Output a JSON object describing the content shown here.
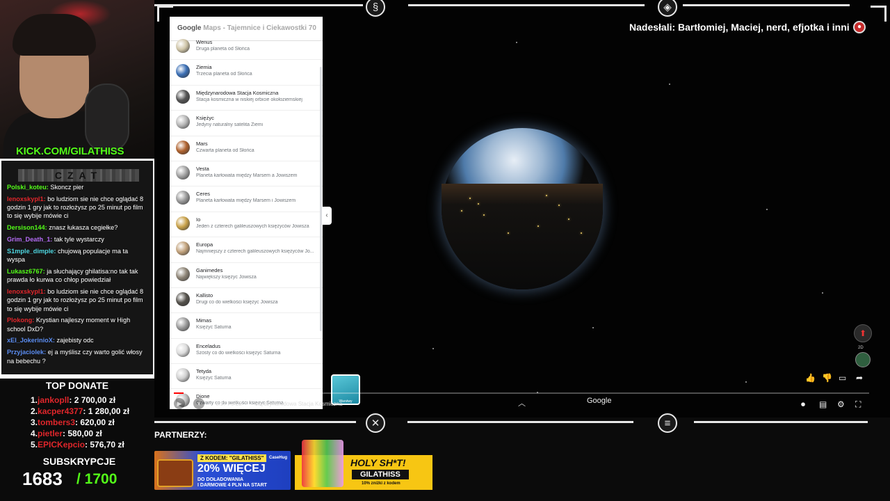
{
  "stream": {
    "kick_url": "KICK.COM/GILATHISS",
    "chat_title": "CZAT",
    "chat_messages": [
      {
        "user": "Polski_koteu:",
        "color": "#53fc18",
        "text": "Skoncz pier"
      },
      {
        "user": "lenoxskypl1:",
        "color": "#e0262b",
        "text": "bo ludziom sie nie chce oglądać 8 godzin 1 gry jak to rozłożysz po 25 minut po film to się wybije mówie ci"
      },
      {
        "user": "Dersison144:",
        "color": "#53fc18",
        "text": "znasz łukasza cegiełke?"
      },
      {
        "user": "Grim_Death_1:",
        "color": "#b46cf5",
        "text": "tak tyle wystarczy"
      },
      {
        "user": "S1mple_dimple:",
        "color": "#4ed6e0",
        "text": "chujową populacje ma ta wyspa"
      },
      {
        "user": "Lukasz6767:",
        "color": "#53fc18",
        "text": "ja słuchający ghilatisa:no tak tak prawda ło kurwa co chłop powiedział"
      },
      {
        "user": "lenoxskypl1:",
        "color": "#e0262b",
        "text": "bo ludziom sie nie chce oglądać 8 godzin 1 gry jak to rozłożysz po 25 minut po film to się wybije mówie ci"
      },
      {
        "user": "Plokong:",
        "color": "#e0262b",
        "text": "Krystian najleszy moment w High school DxD?"
      },
      {
        "user": "xEl_JokerinioX:",
        "color": "#5a8cf0",
        "text": "zajebisty odc"
      },
      {
        "user": "Przyjaciolek:",
        "color": "#5a8cf0",
        "text": "ej a myślisz czy warto golić włosy na bebechu ?"
      }
    ],
    "top_donate_title": "TOP DONATE",
    "donations": [
      {
        "rank": "1.",
        "name": "jankopll",
        "amount": ": 2 700,00 zł"
      },
      {
        "rank": "2.",
        "name": "kacper4377",
        "amount": ": 1 280,00 zł"
      },
      {
        "rank": "3.",
        "name": "tombers3",
        "amount": ": 620,00 zł"
      },
      {
        "rank": "4.",
        "name": "pietler",
        "amount": ": 580,00 zł"
      },
      {
        "rank": "5.",
        "name": "EPICKepcio",
        "amount": ": 576,70 zł"
      }
    ],
    "subs_title": "SUBSKRYPCJE",
    "subs_current": "1683",
    "subs_goal": "/ 1700",
    "partners_label": "PARTNERZY:",
    "banner1": {
      "code": "Z KODEM: \"GILATHISS\"",
      "big": "20% WIĘCEJ",
      "line1": "DO DOŁADOWANIA",
      "line2": "I DARMOWE 4 PLN NA START",
      "brand": "CaseHug"
    },
    "banner2": {
      "big": "HOLY SH*T!",
      "tag": "GILATHISS",
      "small": "10% zniżki z kodem"
    }
  },
  "video": {
    "credit": "Nadesłali: Bartłomiej, Maciej, nerd, efjotka i inni",
    "maps_title_prefix": "Google",
    "maps_title": "Maps - Tajemnice i Ciekawostki 70",
    "maps_items": [
      {
        "name": "Wenus",
        "desc": "Druga planeta od Słońca",
        "color": "#cfc5a8"
      },
      {
        "name": "Ziemia",
        "desc": "Trzecia planeta od Słońca",
        "color": "#3b6fb5"
      },
      {
        "name": "Międzynarodowa Stacja Kosmiczna",
        "desc": "Stacja kosmiczna w niskiej orbicie okołoziemskiej",
        "color": "#555"
      },
      {
        "name": "Księżyc",
        "desc": "Jedyny naturalny satelita Ziemi",
        "color": "#b7b7b7"
      },
      {
        "name": "Mars",
        "desc": "Czwarta planeta od Słońca",
        "color": "#b0632f"
      },
      {
        "name": "Vesta",
        "desc": "Planeta karłowata między Marsem a Jowiszem",
        "color": "#a3a3a3"
      },
      {
        "name": "Ceres",
        "desc": "Planeta karłowata między Marsem i Jowiszem",
        "color": "#9a9a9a"
      },
      {
        "name": "Io",
        "desc": "Jeden z czterech galileuszowych księżyców Jowisza",
        "color": "#c9a24a"
      },
      {
        "name": "Europa",
        "desc": "Najmniejszy z czterech galileuszowych księżyców Jo...",
        "color": "#c2a27c"
      },
      {
        "name": "Ganimedes",
        "desc": "Największy księżyc Jowisza",
        "color": "#8e8577"
      },
      {
        "name": "Kallisto",
        "desc": "Drugi co do wielkości księżyc Jowisza",
        "color": "#55524c"
      },
      {
        "name": "Mimas",
        "desc": "Księżyc Saturna",
        "color": "#9c9c9c"
      },
      {
        "name": "Enceladus",
        "desc": "Szósty co do wielkości księżyc Saturna",
        "color": "#dcdcdc"
      },
      {
        "name": "Tetyda",
        "desc": "Księżyc Saturna",
        "color": "#cfcfcf"
      },
      {
        "name": "Dione",
        "desc": "Czwarty co do wielkości księżyc Saturna",
        "color": "#bdbdbd"
      }
    ],
    "layers_label": "Warstwy",
    "google_watermark": "Google",
    "yt_time": "0:17 / 9:22",
    "yt_chapter": "Międzynarodowa Stacja Kosmiczna",
    "zoom_label": "2D"
  }
}
